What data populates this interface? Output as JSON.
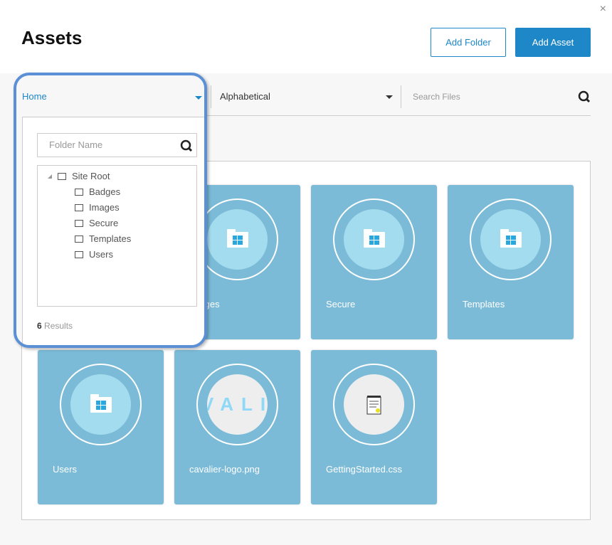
{
  "header": {
    "title": "Assets",
    "close": "×",
    "add_folder": "Add Folder",
    "add_asset": "Add Asset"
  },
  "toolbar": {
    "folder_select": "Home",
    "sort_select": "Alphabetical",
    "search_placeholder": "Search Files"
  },
  "cards": [
    {
      "label": "Badges",
      "type": "folder"
    },
    {
      "label": "Images",
      "type": "folder"
    },
    {
      "label": "Secure",
      "type": "folder"
    },
    {
      "label": "Templates",
      "type": "folder"
    },
    {
      "label": "Users",
      "type": "folder"
    },
    {
      "label": "cavalier-logo.png",
      "type": "image",
      "thumb_text": "VALI"
    },
    {
      "label": "GettingStarted.css",
      "type": "file"
    }
  ],
  "dropdown": {
    "search_placeholder": "Folder Name",
    "root": "Site Root",
    "folders": [
      "Badges",
      "Images",
      "Secure",
      "Templates",
      "Users"
    ],
    "results_count": "6",
    "results_label": "Results"
  },
  "colors": {
    "accent": "#1d87c8",
    "card": "#7bbbd7",
    "highlight": "#5b8fd6"
  }
}
